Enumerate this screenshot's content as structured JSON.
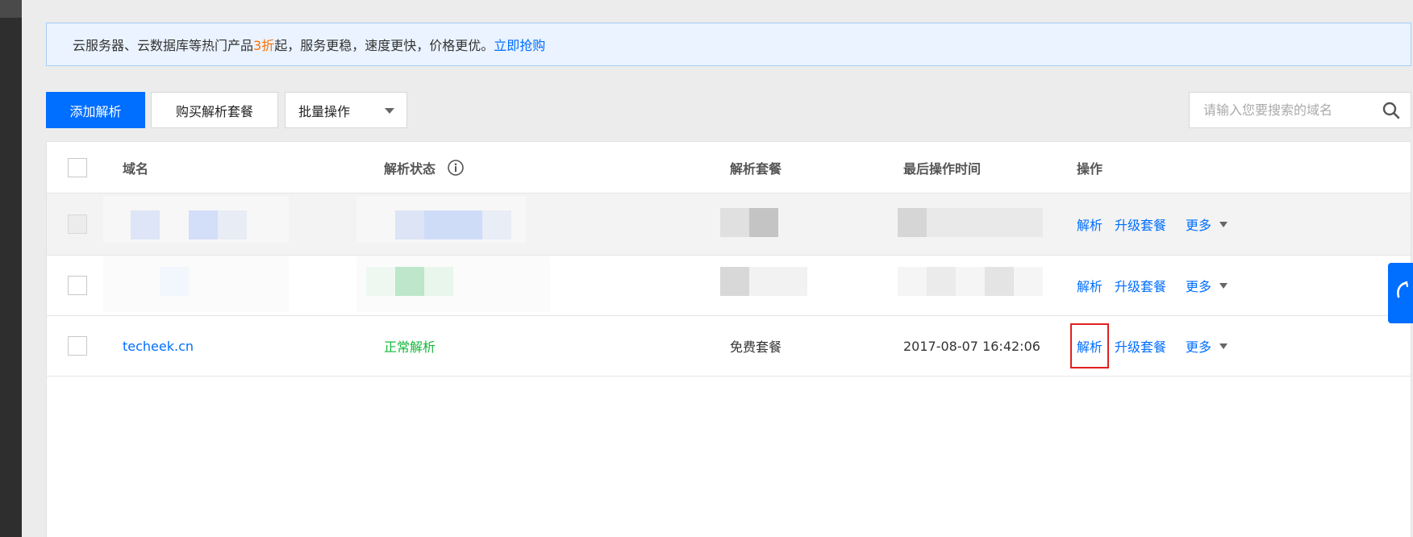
{
  "promo": {
    "text_before": "云服务器、云数据库等热门产品",
    "highlight": "3折",
    "text_after": "起，服务更稳，速度更快，价格更优。",
    "link": "立即抢购",
    "highlight_color": "#ff7200"
  },
  "toolbar": {
    "add_label": "添加解析",
    "buy_label": "购买解析套餐",
    "batch_label": "批量操作"
  },
  "search": {
    "placeholder": "请输入您要搜索的域名",
    "icon": "search-icon"
  },
  "table": {
    "headers": {
      "domain": "域名",
      "status": "解析状态",
      "package": "解析套餐",
      "last_time": "最后操作时间",
      "actions": "操作"
    },
    "actions": {
      "resolve": "解析",
      "upgrade": "升级套餐",
      "more": "更多"
    },
    "rows": [
      {
        "domain": "techeek.cn",
        "status": "正常解析",
        "package": "免费套餐",
        "last_time": "2017-08-07 16:42:06"
      }
    ]
  },
  "colors": {
    "primary": "#006eff",
    "status_ok": "#14b93a",
    "highlight_box": "#e02020"
  }
}
